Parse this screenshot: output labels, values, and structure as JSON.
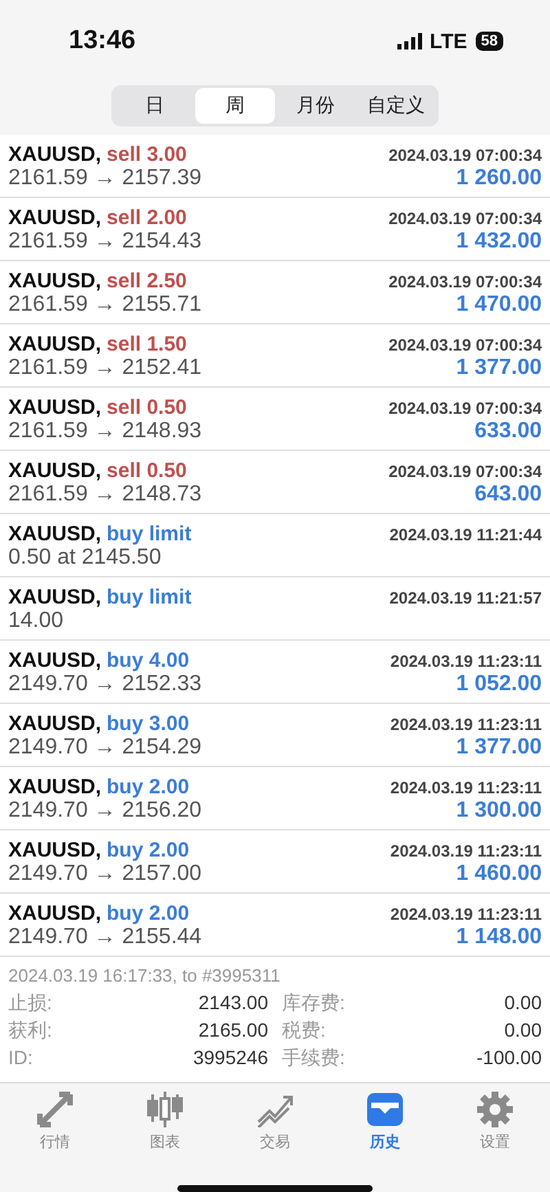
{
  "status_bar": {
    "time": "13:46",
    "network": "LTE",
    "battery": "58"
  },
  "period_tabs": [
    {
      "label": "日",
      "selected": false
    },
    {
      "label": "周",
      "selected": true
    },
    {
      "label": "月份",
      "selected": false
    },
    {
      "label": "自定义",
      "selected": false
    }
  ],
  "deals": [
    {
      "symbol": "XAUUSD,",
      "kind": "sell",
      "order": "sell 3.00",
      "time": "2024.03.19 07:00:34",
      "prices": "2161.59 → 2157.39",
      "profit": "1 260.00"
    },
    {
      "symbol": "XAUUSD,",
      "kind": "sell",
      "order": "sell 2.00",
      "time": "2024.03.19 07:00:34",
      "prices": "2161.59 → 2154.43",
      "profit": "1 432.00"
    },
    {
      "symbol": "XAUUSD,",
      "kind": "sell",
      "order": "sell 2.50",
      "time": "2024.03.19 07:00:34",
      "prices": "2161.59 → 2155.71",
      "profit": "1 470.00"
    },
    {
      "symbol": "XAUUSD,",
      "kind": "sell",
      "order": "sell 1.50",
      "time": "2024.03.19 07:00:34",
      "prices": "2161.59 → 2152.41",
      "profit": "1 377.00"
    },
    {
      "symbol": "XAUUSD,",
      "kind": "sell",
      "order": "sell 0.50",
      "time": "2024.03.19 07:00:34",
      "prices": "2161.59 → 2148.93",
      "profit": "633.00"
    },
    {
      "symbol": "XAUUSD,",
      "kind": "sell",
      "order": "sell 0.50",
      "time": "2024.03.19 07:00:34",
      "prices": "2161.59 → 2148.73",
      "profit": "643.00"
    },
    {
      "symbol": "XAUUSD,",
      "kind": "buy",
      "order": "buy limit",
      "time": "2024.03.19 11:21:44",
      "prices": "0.50 at 2145.50"
    },
    {
      "symbol": "XAUUSD,",
      "kind": "buy",
      "order": "buy limit",
      "time": "2024.03.19 11:21:57",
      "prices": "14.00"
    },
    {
      "symbol": "XAUUSD,",
      "kind": "buy",
      "order": "buy 4.00",
      "time": "2024.03.19 11:23:11",
      "prices": "2149.70 → 2152.33",
      "profit": "1 052.00"
    },
    {
      "symbol": "XAUUSD,",
      "kind": "buy",
      "order": "buy 3.00",
      "time": "2024.03.19 11:23:11",
      "prices": "2149.70 → 2154.29",
      "profit": "1 377.00"
    },
    {
      "symbol": "XAUUSD,",
      "kind": "buy",
      "order": "buy 2.00",
      "time": "2024.03.19 11:23:11",
      "prices": "2149.70 → 2156.20",
      "profit": "1 300.00"
    },
    {
      "symbol": "XAUUSD,",
      "kind": "buy",
      "order": "buy 2.00",
      "time": "2024.03.19 11:23:11",
      "prices": "2149.70 → 2157.00",
      "profit": "1 460.00"
    },
    {
      "symbol": "XAUUSD,",
      "kind": "buy",
      "order": "buy 2.00",
      "time": "2024.03.19 11:23:11",
      "prices": "2149.70 → 2155.44",
      "profit": "1 148.00"
    }
  ],
  "detail": {
    "header": "2024.03.19 16:17:33, to #3995311",
    "fields": [
      {
        "label": "止损:",
        "value": "2143.00"
      },
      {
        "label": "库存费:",
        "value": "0.00"
      },
      {
        "label": "获利:",
        "value": "2165.00"
      },
      {
        "label": "税费:",
        "value": "0.00"
      },
      {
        "label": "ID:",
        "value": "3995246"
      },
      {
        "label": "手续费:",
        "value": "-100.00"
      }
    ]
  },
  "bottom_tabs": [
    {
      "kind": "quotes",
      "label": "行情",
      "selected": false
    },
    {
      "kind": "chart",
      "label": "图表",
      "selected": false
    },
    {
      "kind": "trade",
      "label": "交易",
      "selected": false
    },
    {
      "kind": "history",
      "label": "历史",
      "selected": true
    },
    {
      "kind": "settings",
      "label": "设置",
      "selected": false
    }
  ]
}
